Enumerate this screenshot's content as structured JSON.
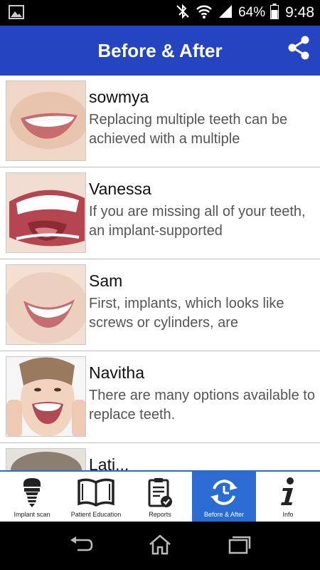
{
  "status_bar": {
    "battery": "64%",
    "time": "9:48"
  },
  "app_bar": {
    "title": "Before & After",
    "share_icon": "share-icon"
  },
  "items": [
    {
      "name": "sowmya",
      "description": "Replacing multiple teeth can be achieved with a multiple"
    },
    {
      "name": "Vanessa",
      "description": "If you are missing all of your teeth, an implant-supported"
    },
    {
      "name": "Sam",
      "description": "First, implants, which looks like screws or cylinders, are"
    },
    {
      "name": "Navitha",
      "description": "There are many options available to replace teeth."
    },
    {
      "name": "Lati...",
      "description": ""
    }
  ],
  "bottom_nav": [
    {
      "label": "Implant scan",
      "icon": "implant-icon"
    },
    {
      "label": "Patient Education",
      "icon": "book-icon"
    },
    {
      "label": "Reports",
      "icon": "clipboard-icon"
    },
    {
      "label": "Before & After",
      "icon": "refresh-clock-icon",
      "active": true
    },
    {
      "label": "Info",
      "icon": "info-icon"
    }
  ],
  "colors": {
    "app_bar": "#2445bf",
    "active_tab": "#2b6cd3"
  }
}
